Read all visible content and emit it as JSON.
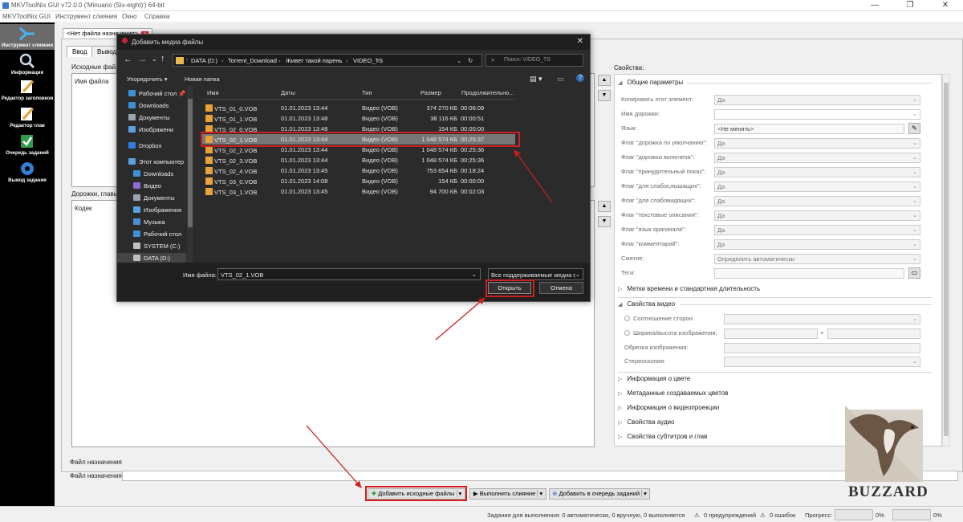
{
  "window": {
    "title": "MKVToolNix GUI v72.0.0 ('Minuano (Six-eight)') 64-bit",
    "minimize": "—",
    "maximize": "❐",
    "close": "✕"
  },
  "menu": [
    "MKVToolNix GUI",
    "Инструмент слияния",
    "Окно",
    "Справка"
  ],
  "sidebar": [
    {
      "label": "Инструмент слияния",
      "icon": "merge-icon",
      "active": true
    },
    {
      "label": "Информация",
      "icon": "info-icon"
    },
    {
      "label": "Редактор заголовков",
      "icon": "header-editor-icon"
    },
    {
      "label": "Редактор глав",
      "icon": "chapter-editor-icon"
    },
    {
      "label": "Очередь заданий",
      "icon": "job-queue-icon"
    },
    {
      "label": "Вывод задания",
      "icon": "job-output-icon"
    }
  ],
  "doc_tab": "<Нет файла назначения>",
  "tabs": [
    "Ввод",
    "Вывод"
  ],
  "input": {
    "source_files_label": "Исходные файлы:",
    "filename_col": "Имя файла",
    "tracks_label": "Дорожки, главы",
    "codec_col": "Кодек",
    "properties_label": "Свойства:"
  },
  "dialog": {
    "title": "Добавить медиа файлы",
    "close": "✕",
    "path": [
      "DATA (D:)",
      "Torrent_Download",
      "Живет такой парень",
      "VIDEO_TS"
    ],
    "search_placeholder": "Поиск: VIDEO_TS",
    "organize": "Упорядочить ▾",
    "new_folder": "Новая папка",
    "columns": [
      "Имя",
      "Даты",
      "Тип",
      "Размер",
      "Продолжительно..."
    ],
    "tree": [
      {
        "label": "Рабочий стол",
        "pin": true,
        "color": "#3d8fd6"
      },
      {
        "label": "Downloads",
        "pin": true,
        "color": "#3d8fd6"
      },
      {
        "label": "Документы",
        "pin": true,
        "color": "#9aa4b0"
      },
      {
        "label": "Изображени",
        "pin": true,
        "color": "#5aa0e0"
      },
      {
        "label": "Dropbox",
        "pin": false,
        "color": "#2e7de0"
      },
      {
        "label": "Этот компьютер",
        "pin": false,
        "color": "#5aa0e0"
      },
      {
        "label": "Downloads",
        "pin": false,
        "color": "#3d8fd6"
      },
      {
        "label": "Видео",
        "pin": false,
        "color": "#8a6dd6"
      },
      {
        "label": "Документы",
        "pin": false,
        "color": "#9aa4b0"
      },
      {
        "label": "Изображения",
        "pin": false,
        "color": "#5aa0e0"
      },
      {
        "label": "Музыка",
        "pin": false,
        "color": "#4a8fd6"
      },
      {
        "label": "Рабочий стол",
        "pin": false,
        "color": "#3d8fd6"
      },
      {
        "label": "SYSTEM (C:)",
        "pin": false,
        "color": "#bfbfbf"
      },
      {
        "label": "DATA (D:)",
        "pin": false,
        "color": "#bfbfbf"
      }
    ],
    "files": [
      {
        "name": "VTS_01_0.VOB",
        "date": "01.01.2023 13:44",
        "type": "Видео (VOB)",
        "size": "374 270 КБ",
        "duration": "00:06:09"
      },
      {
        "name": "VTS_01_1.VOB",
        "date": "01.01.2023 13:48",
        "type": "Видео (VOB)",
        "size": "38 116 КБ",
        "duration": "00:00:51"
      },
      {
        "name": "VTS_02_0.VOB",
        "date": "01.01.2023 13:48",
        "type": "Видео (VOB)",
        "size": "154 КБ",
        "duration": "00:00:00"
      },
      {
        "name": "VTS_02_1.VOB",
        "date": "01.01.2023 13:44",
        "type": "Видео (VOB)",
        "size": "1 048 574 КБ",
        "duration": "00:25:37",
        "selected": true
      },
      {
        "name": "VTS_02_2.VOB",
        "date": "01.01.2023 13:44",
        "type": "Видео (VOB)",
        "size": "1 048 574 КБ",
        "duration": "00:25:36"
      },
      {
        "name": "VTS_02_3.VOB",
        "date": "01.01.2023 13:44",
        "type": "Видео (VOB)",
        "size": "1 048 574 КБ",
        "duration": "00:25:36"
      },
      {
        "name": "VTS_02_4.VOB",
        "date": "01.01.2023 13:45",
        "type": "Видео (VOB)",
        "size": "753 654 КБ",
        "duration": "00:18:24"
      },
      {
        "name": "VTS_03_0.VOB",
        "date": "01.01.2023 14:08",
        "type": "Видео (VOB)",
        "size": "154 КБ",
        "duration": "00:00:00"
      },
      {
        "name": "VTS_03_1.VOB",
        "date": "01.01.2023 13:45",
        "type": "Видео (VOB)",
        "size": "94 700 КБ",
        "duration": "00:02:03"
      }
    ],
    "filename_label": "Имя файла:",
    "filename_value": "VTS_02_1.VOB",
    "filetype_value": "Все поддерживаемые медиа ф",
    "open": "Открыть",
    "cancel": "Отмена"
  },
  "props": {
    "general": "Общие параметры",
    "rows": [
      {
        "label": "Копировать этот элемент:",
        "value": "Да"
      },
      {
        "label": "Имя дорожки:",
        "value": ""
      },
      {
        "label": "Язык:",
        "value": "<Не менять>"
      },
      {
        "label": "Флаг \"дорожка по умолчанию\":",
        "value": "Да"
      },
      {
        "label": "Флаг \"дорожка включена\":",
        "value": "Да"
      },
      {
        "label": "Флаг \"принудительный показ\":",
        "value": "Да"
      },
      {
        "label": "Флаг \"для слабослышащих\":",
        "value": "Да"
      },
      {
        "label": "Флаг \"для слабовидящих\":",
        "value": "Да"
      },
      {
        "label": "Флаг \"текстовые описания\":",
        "value": "Да"
      },
      {
        "label": "Флаг \"язык оригинала\":",
        "value": "Да"
      },
      {
        "label": "Флаг \"комментарий\":",
        "value": "Да"
      },
      {
        "label": "Сжатие:",
        "value": "Определить автоматически"
      },
      {
        "label": "Теги:",
        "value": ""
      }
    ],
    "timestamps": "Метки времени и стандартная длительность",
    "video": "Свойства видео",
    "aspect": "Соотношение сторон:",
    "wh": "Ширина/высота изображения:",
    "times": "×",
    "crop": "Обрезка изображения:",
    "stereo": "Стереоскопия:",
    "color_info": "Информация о цвете",
    "color_meta": "Метаданные создаваемых цветов",
    "projection": "Информация о видеопроекции",
    "audio": "Свойства аудио",
    "subs": "Свойства субтитров и глав"
  },
  "output": {
    "dest_group": "Файл назначения",
    "dest_label": "Файл назначения:"
  },
  "actions": {
    "add": "Добавить исходные файлы",
    "merge": "Выполнить слияние",
    "queue": "Добавить в очередь заданий"
  },
  "status": {
    "jobs": "Задания для выполнения:  0 автоматически, 0 вручную, 0 выполняется",
    "warnings": "0 предупреждений",
    "errors": "0 ошибок",
    "progress_label": "Прогресс:",
    "progress1": "0%",
    "progress2": "0%"
  },
  "watermark": "BUZZARD"
}
